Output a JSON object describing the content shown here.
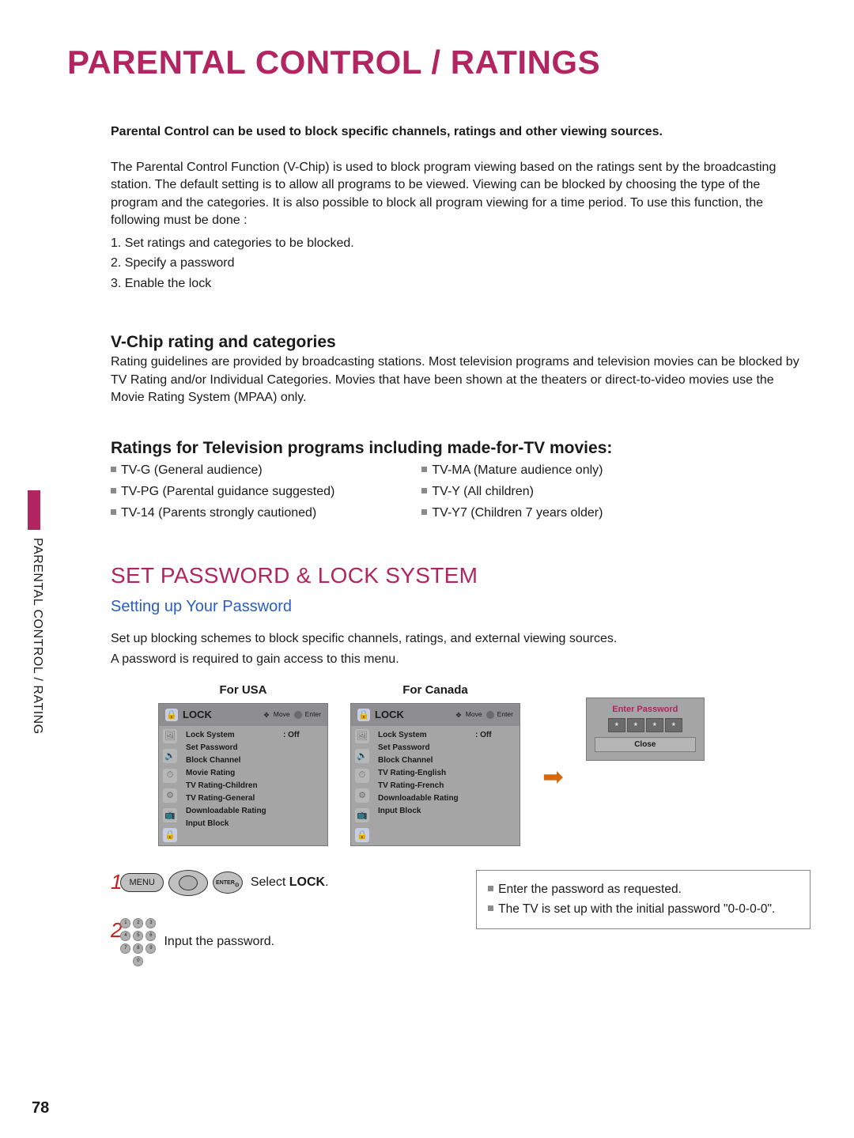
{
  "page_number": "78",
  "side_label": "PARENTAL CONTROL / RATING",
  "title": "PARENTAL CONTROL / RATINGS",
  "intro_bold": "Parental Control can be used to block specific channels, ratings and other viewing sources.",
  "intro_para": "The Parental Control Function (V-Chip) is used to block program viewing based on the ratings sent by the broadcasting station. The default setting is to allow all programs to be viewed. Viewing can be blocked by choosing the type of the program and the categories. It is also possible to block all program viewing for a time period. To use this function, the following must be done :",
  "intro_steps": [
    "1. Set ratings and categories to be blocked.",
    "2. Specify a password",
    "3. Enable the lock"
  ],
  "vchip": {
    "heading": "V-Chip rating and categories",
    "para": "Rating guidelines are provided by broadcasting stations. Most television programs and television movies can be blocked by TV Rating and/or Individual Categories. Movies that have been shown at the theaters or direct-to-video movies use the Movie Rating System (MPAA) only."
  },
  "ratings": {
    "heading": "Ratings for Television programs including made-for-TV movies:",
    "left": [
      "TV-G   (General audience)",
      "TV-PG (Parental guidance suggested)",
      "TV-14  (Parents strongly cautioned)"
    ],
    "right": [
      "TV-MA (Mature audience only)",
      "TV-Y    (All children)",
      "TV-Y7  (Children 7 years older)"
    ]
  },
  "setpw": {
    "heading": "SET PASSWORD & LOCK SYSTEM",
    "sub": "Setting up Your Password",
    "p1": "Set up blocking schemes to block specific channels, ratings, and external viewing sources.",
    "p2": "A password is required to gain access to this menu."
  },
  "panels": {
    "usa_label": "For USA",
    "canada_label": "For Canada",
    "title": "LOCK",
    "move": "Move",
    "enter": "Enter",
    "lock_system": "Lock System",
    "lock_system_val": ": Off",
    "usa_items": [
      "Set Password",
      "Block Channel",
      "Movie Rating",
      "TV Rating-Children",
      "TV Rating-General",
      "Downloadable Rating",
      "Input Block"
    ],
    "canada_items": [
      "Set Password",
      "Block Channel",
      "TV Rating-English",
      "TV Rating-French",
      "Downloadable Rating",
      "Input Block"
    ]
  },
  "pwbox": {
    "title": "Enter Password",
    "star": "*",
    "close": "Close"
  },
  "steps": {
    "n1": "1",
    "n2": "2",
    "menu_btn": "MENU",
    "enter_btn": "ENTER",
    "s1_text_pre": "Select ",
    "s1_text_bold": "LOCK",
    "s1_text_post": ".",
    "s2_text": "Input the password."
  },
  "notes": {
    "l1": "Enter the password as requested.",
    "l2": "The TV is set up with the initial password \"0-0-0-0\"."
  },
  "icons": {
    "tv": "📺",
    "pic": "🖼",
    "aud": "🔊",
    "time": "⏱",
    "opt": "⚙",
    "lock": "🔒"
  }
}
